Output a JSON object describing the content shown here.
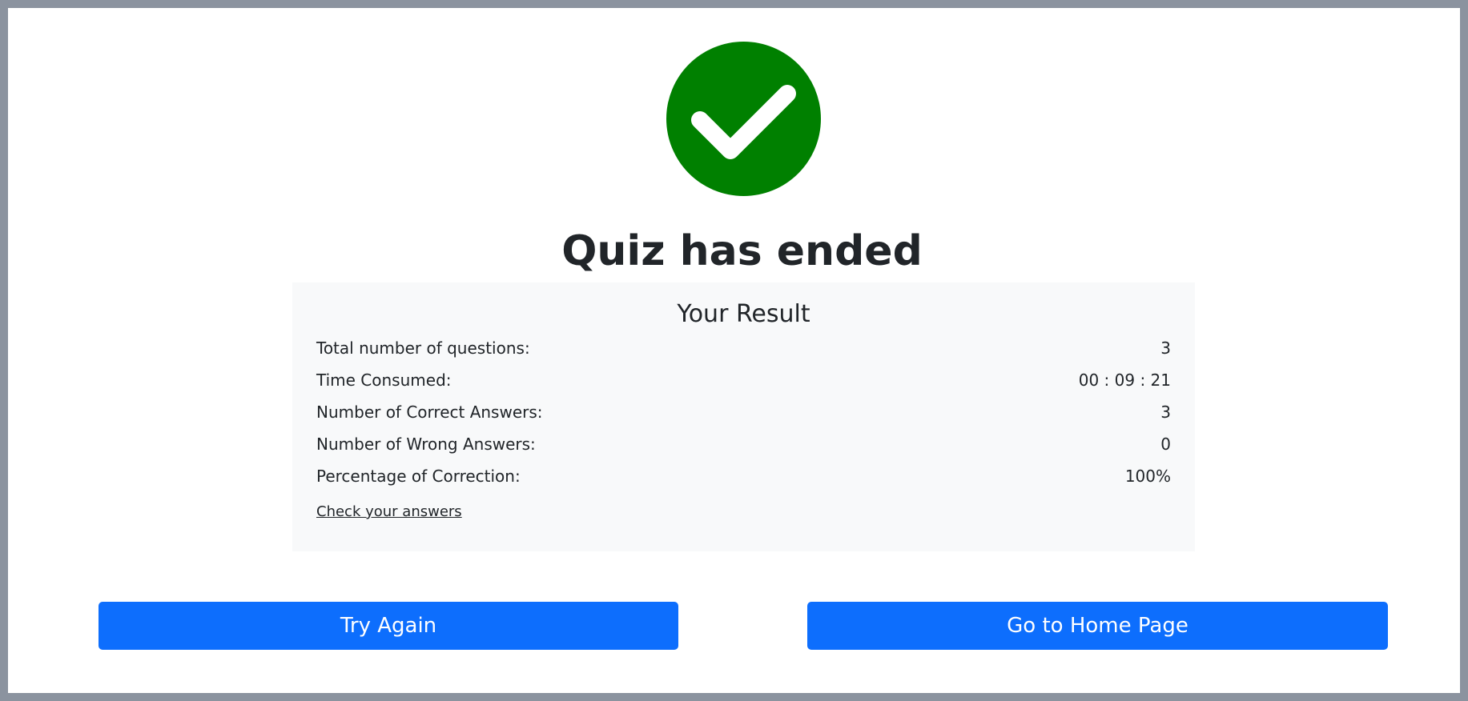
{
  "colors": {
    "success": "#008000",
    "primary_button": "#0d6efd",
    "panel_background": "#f8f9fa",
    "frame_border": "#8b939f"
  },
  "icon": "check-circle-icon",
  "title": "Quiz has ended",
  "result": {
    "heading": "Your Result",
    "rows": [
      {
        "label": "Total number of questions:",
        "value": "3"
      },
      {
        "label": "Time Consumed:",
        "value": "00 : 09 : 21"
      },
      {
        "label": "Number of Correct Answers:",
        "value": "3"
      },
      {
        "label": "Number of Wrong Answers:",
        "value": "0"
      },
      {
        "label": "Percentage of Correction:",
        "value": "100%"
      }
    ],
    "check_link": "Check your answers"
  },
  "buttons": {
    "try_again": "Try Again",
    "home": "Go to Home Page"
  }
}
